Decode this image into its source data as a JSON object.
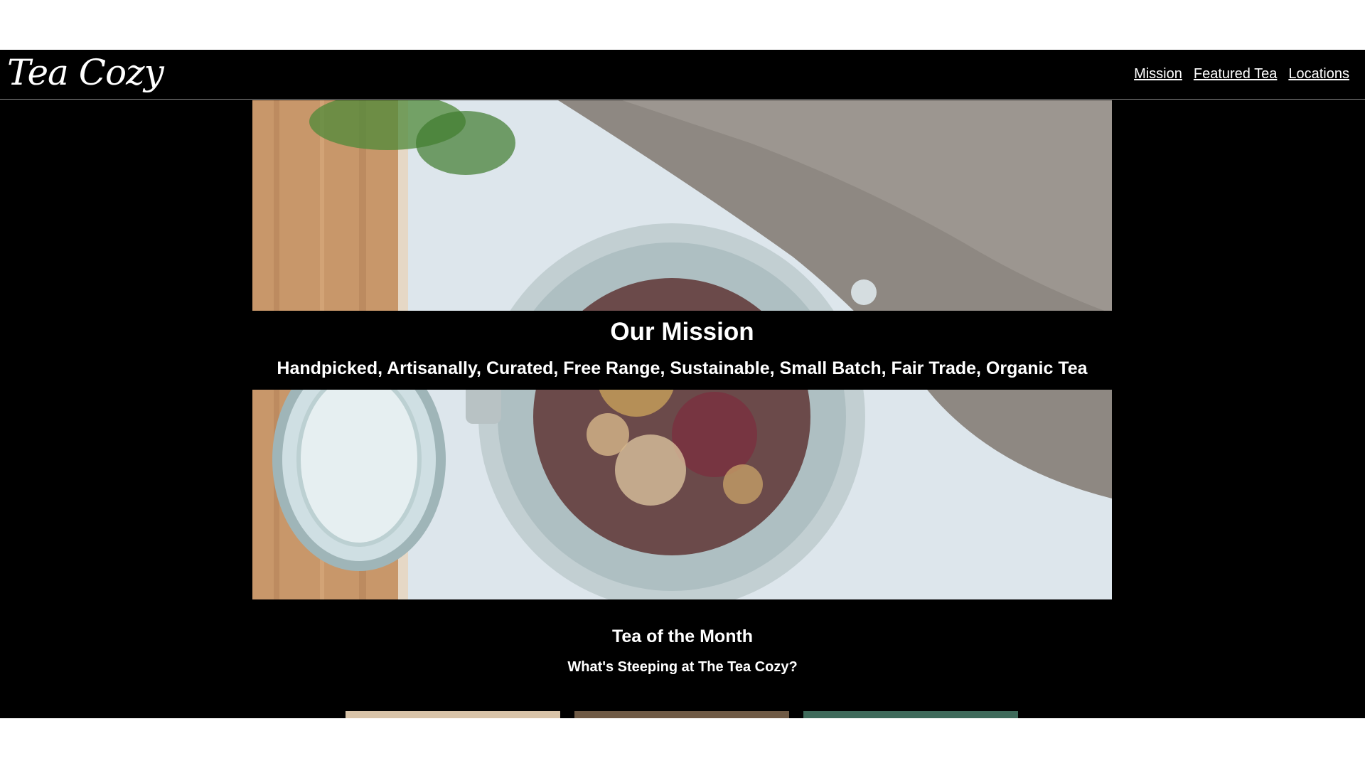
{
  "header": {
    "logo": "Tea Cozy",
    "nav": [
      {
        "label": "Mission"
      },
      {
        "label": "Featured Tea"
      },
      {
        "label": "Locations"
      }
    ]
  },
  "hero": {
    "image_icon": "loose-leaf-tea-jar-photo",
    "title": "Our Mission",
    "subtitle": "Handpicked, Artisanally, Curated, Free Range, Sustainable, Small Batch, Fair Trade, Organic Tea"
  },
  "tea_of_month": {
    "title": "Tea of the Month",
    "subtitle": "What's Steeping at The Tea Cozy?",
    "thumbnails": [
      {
        "icon": "tea-thumbnail-1",
        "color": "#d8c3a8"
      },
      {
        "icon": "tea-thumbnail-2",
        "color": "#6f5a45"
      },
      {
        "icon": "tea-thumbnail-3",
        "color": "#3e6a5a"
      }
    ]
  },
  "colors": {
    "background": "#000000",
    "text": "#ffffff",
    "page_margin": "#ffffff"
  }
}
